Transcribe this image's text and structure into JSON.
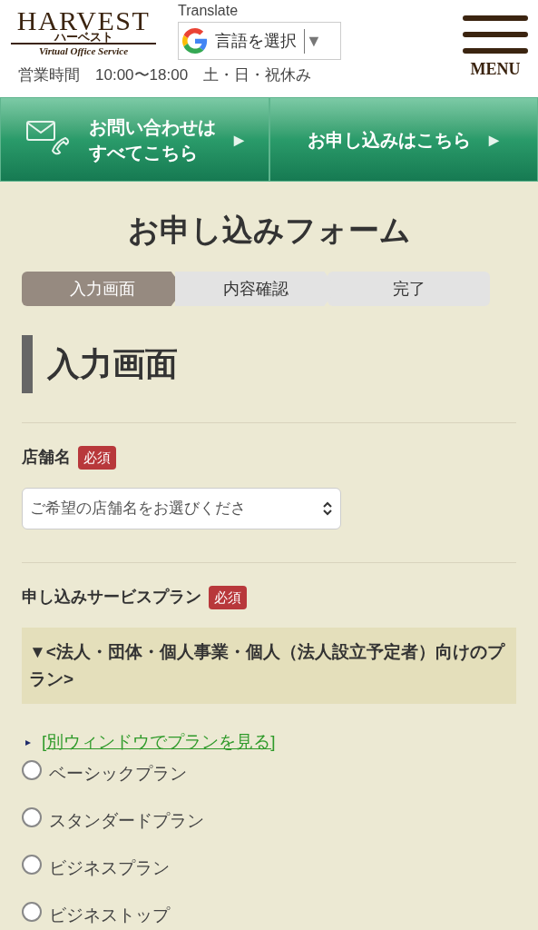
{
  "header": {
    "logo": {
      "title": "HARVEST",
      "kana": "ハーベスト",
      "tagline": "Virtual Office Service"
    },
    "translate": {
      "label": "Translate",
      "select": "言語を選択",
      "arrow": "▼"
    },
    "hours": "営業時間　10:00〜18:00　土・日・祝休み",
    "menu": "MENU"
  },
  "nav_buttons": [
    {
      "kind": "contact",
      "lines": [
        "お問い合わせは",
        "すべてこちら"
      ],
      "arrow": "▶"
    },
    {
      "kind": "apply",
      "lines": [
        "お申し込みはこちら"
      ],
      "arrow": "▶"
    }
  ],
  "page_title": "お申し込みフォーム",
  "steps": [
    {
      "label": "入力画面",
      "selected": true
    },
    {
      "label": "内容確認",
      "selected": false
    },
    {
      "label": "完了",
      "selected": false
    }
  ],
  "section_heading": "入力画面",
  "fields": [
    {
      "kind": "select",
      "label": "店舗名",
      "required": "必須",
      "placeholder": "ご希望の店舗名をお選びくださ"
    },
    {
      "kind": "radio",
      "label": "申し込みサービスプラン",
      "required": "必須",
      "group": "▼<法人・団体・個人事業・個人（法人設立予定者）向けのプラン>",
      "link_marker": "▸",
      "link": "[別ウィンドウでプランを見る]",
      "options": [
        {
          "label": "ベーシックプラン",
          "checked": false
        },
        {
          "label": "スタンダードプラン",
          "checked": false
        },
        {
          "label": "ビジネスプラン",
          "checked": false
        },
        {
          "label": "ビジネストップ",
          "checked": false
        }
      ]
    }
  ]
}
